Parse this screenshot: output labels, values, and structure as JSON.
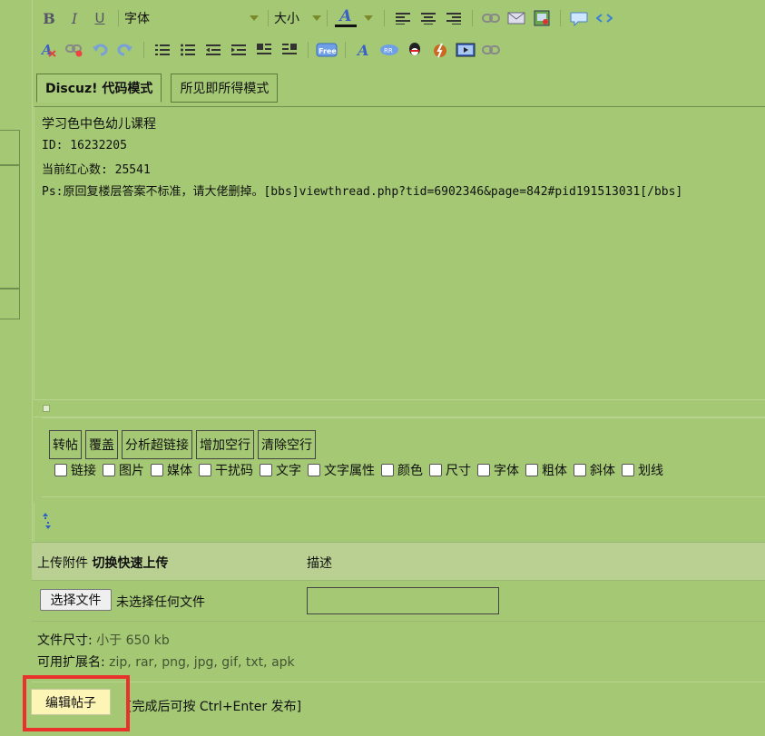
{
  "toolbar": {
    "font_label": "字体",
    "size_label": "大小",
    "text_color_glyph": "A",
    "bold_glyph": "B",
    "italic_glyph": "I",
    "underline_glyph": "U",
    "accent_color": "#3a5fc8"
  },
  "tabs": [
    {
      "label": "Discuz! 代码模式",
      "active": true
    },
    {
      "label": "所见即所得模式",
      "active": false
    }
  ],
  "editor": {
    "lines": [
      "学习色中色幼儿课程",
      "ID: 16232205",
      "当前红心数: 25541",
      "Ps:原回复楼层答案不标准，请大佬删掉。[bbs]viewthread.php?tid=6902346&page=842#pid191513031[/bbs]"
    ]
  },
  "helper": {
    "buttons": [
      "转帖",
      "覆盖",
      "分析超链接",
      "增加空行",
      "清除空行"
    ],
    "checkboxes": [
      "链接",
      "图片",
      "媒体",
      "干扰码",
      "文字",
      "文字属性",
      "颜色",
      "尺寸",
      "字体",
      "粗体",
      "斜体",
      "划线"
    ]
  },
  "upload": {
    "header_prefix": "上传附件",
    "header_toggle": "切换快速上传",
    "desc_header": "描述",
    "choose_file": "选择文件",
    "no_file": "未选择任何文件",
    "size_label": "文件尺寸:",
    "size_value": "小于 650 kb",
    "ext_label": "可用扩展名:",
    "ext_value": "zip, rar, png, jpg, gif, txt, apk"
  },
  "submit": {
    "label": "编辑帖子",
    "hint": "[完成后可按 Ctrl+Enter 发布]"
  },
  "colors": {
    "background": "#a4c874",
    "highlight_frame": "#e8322b",
    "submit_bg": "#fdf5b6"
  }
}
